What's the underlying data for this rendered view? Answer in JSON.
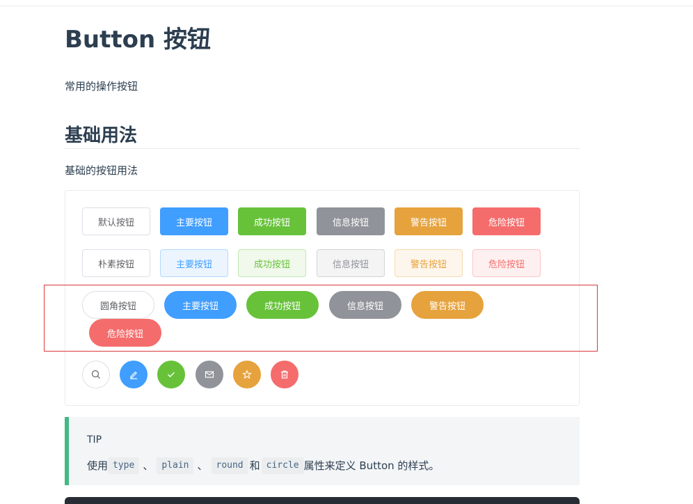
{
  "page": {
    "title": "Button 按钮",
    "description": "常用的操作按钮",
    "section_title": "基础用法",
    "section_description": "基础的按钮用法"
  },
  "rows": {
    "default": [
      "默认按钮",
      "主要按钮",
      "成功按钮",
      "信息按钮",
      "警告按钮",
      "危险按钮"
    ],
    "plain": [
      "朴素按钮",
      "主要按钮",
      "成功按钮",
      "信息按钮",
      "警告按钮",
      "危险按钮"
    ],
    "round": [
      "圆角按钮",
      "主要按钮",
      "成功按钮",
      "信息按钮",
      "警告按钮",
      "危险按钮"
    ],
    "circle_icons": [
      "search-icon",
      "edit-icon",
      "check-icon",
      "message-icon",
      "star-icon",
      "delete-icon"
    ]
  },
  "tip": {
    "title": "TIP",
    "prefix": "使用",
    "codes": [
      "type",
      "plain",
      "round",
      "circle"
    ],
    "sep": "、",
    "and": "和",
    "suffix": "属性来定义 Button 的样式。"
  },
  "colors": {
    "primary": "#409eff",
    "success": "#67c23a",
    "info": "#909399",
    "warning": "#e6a23c",
    "danger": "#f56c6c",
    "tip_accent": "#42b983"
  }
}
